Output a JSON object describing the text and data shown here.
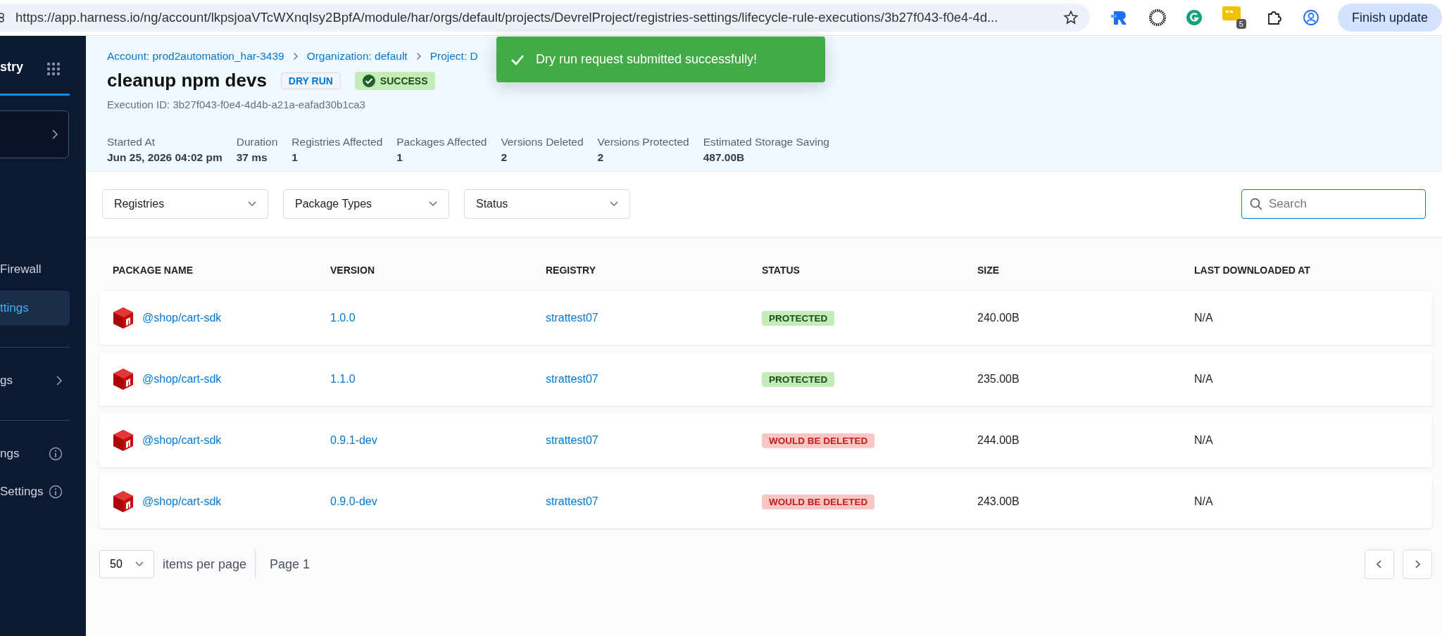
{
  "browser": {
    "url": "https://app.harness.io/ng/account/lkpsjoaVTcWXnqIsy2BpfA/module/har/orgs/default/projects/DevrelProject/registries-settings/lifecycle-rule-executions/3b27f043-f0e4-4d...",
    "extension_badge": "5",
    "update_button": "Finish update"
  },
  "sidebar": {
    "title": "stry",
    "items": [
      {
        "label": "Firewall",
        "selected": false,
        "kind": "plain"
      },
      {
        "label": "ttings",
        "selected": true,
        "kind": "plain"
      },
      {
        "label": "gs",
        "selected": false,
        "kind": "chevron"
      },
      {
        "label": "ngs",
        "selected": false,
        "kind": "info"
      },
      {
        "label": "Settings",
        "selected": false,
        "kind": "info"
      }
    ]
  },
  "breadcrumbs": [
    "Account: prod2automation_har-3439",
    "Organization: default",
    "Project: D"
  ],
  "title": "cleanup npm devs",
  "badges": [
    {
      "label": "DRY RUN",
      "kind": "mode"
    },
    {
      "label": "SUCCESS",
      "kind": "success"
    }
  ],
  "execution_id": "Execution ID: 3b27f043-f0e4-4d4b-a21a-eafad30b1ca3",
  "stats": [
    {
      "label": "Started At",
      "value": "Jun 25, 2026 04:02 pm"
    },
    {
      "label": "Duration",
      "value": "37 ms"
    },
    {
      "label": "Registries Affected",
      "value": "1"
    },
    {
      "label": "Packages Affected",
      "value": "1"
    },
    {
      "label": "Versions Deleted",
      "value": "2"
    },
    {
      "label": "Versions Protected",
      "value": "2"
    },
    {
      "label": "Estimated Storage Saving",
      "value": "487.00B"
    }
  ],
  "filters": [
    "Registries",
    "Package Types",
    "Status"
  ],
  "search": {
    "placeholder": "Search"
  },
  "toast": {
    "message": "Dry run request submitted successfully!"
  },
  "table": {
    "columns": [
      "PACKAGE NAME",
      "VERSION",
      "REGISTRY",
      "STATUS",
      "SIZE",
      "LAST DOWNLOADED AT"
    ],
    "rows": [
      {
        "package": "@shop/cart-sdk",
        "version": "1.0.0",
        "registry": "strattest07",
        "status": "PROTECTED",
        "kind": "protected",
        "size": "240.00B",
        "last_downloaded": "N/A"
      },
      {
        "package": "@shop/cart-sdk",
        "version": "1.1.0",
        "registry": "strattest07",
        "status": "PROTECTED",
        "kind": "protected",
        "size": "235.00B",
        "last_downloaded": "N/A"
      },
      {
        "package": "@shop/cart-sdk",
        "version": "0.9.1-dev",
        "registry": "strattest07",
        "status": "WOULD BE DELETED",
        "kind": "deleted",
        "size": "244.00B",
        "last_downloaded": "N/A"
      },
      {
        "package": "@shop/cart-sdk",
        "version": "0.9.0-dev",
        "registry": "strattest07",
        "status": "WOULD BE DELETED",
        "kind": "deleted",
        "size": "243.00B",
        "last_downloaded": "N/A"
      }
    ]
  },
  "pagination": {
    "page_size": "50",
    "page_size_label": "items per page",
    "page": "Page 1"
  }
}
